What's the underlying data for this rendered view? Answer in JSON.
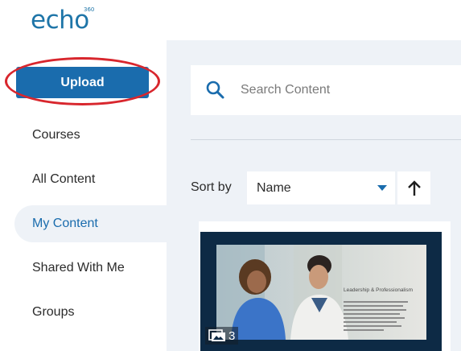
{
  "app": {
    "logo_text": "echo",
    "logo_superscript": "360"
  },
  "sidebar": {
    "upload_label": "Upload",
    "items": [
      {
        "label": "Courses",
        "active": false
      },
      {
        "label": "All Content",
        "active": false
      },
      {
        "label": "My Content",
        "active": true
      },
      {
        "label": "Shared With Me",
        "active": false
      },
      {
        "label": "Groups",
        "active": false
      }
    ]
  },
  "search": {
    "placeholder": "Search Content",
    "value": "",
    "icon": "search-icon"
  },
  "sort": {
    "label": "Sort by",
    "selected": "Name",
    "direction_icon": "arrow-up-icon"
  },
  "content_card": {
    "thumbnail_slide_title": "Leadership & Professionalism",
    "media_count": "3",
    "media_icon": "image-stack-icon"
  },
  "colors": {
    "brand_blue": "#1a6cad",
    "highlight_red": "#d8262d",
    "background_gray": "#eef2f7",
    "thumbnail_frame": "#0d2a45"
  }
}
